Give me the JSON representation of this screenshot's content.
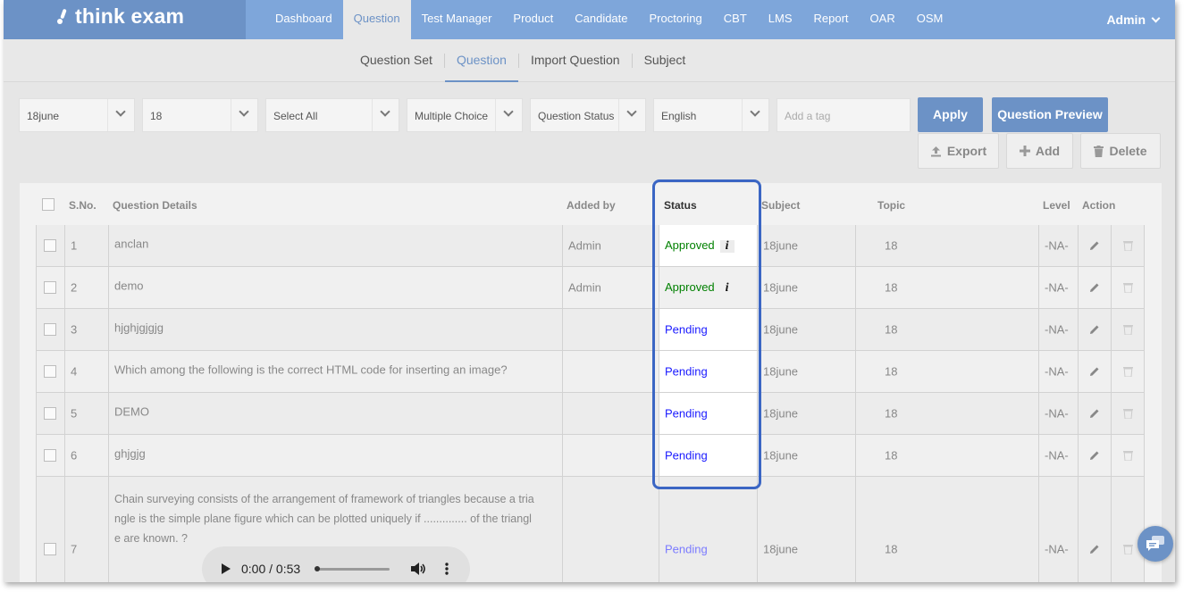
{
  "brand": {
    "logo_text": "think exam"
  },
  "nav": {
    "items": [
      "Dashboard",
      "Question",
      "Test Manager",
      "Product",
      "Candidate",
      "Proctoring",
      "CBT",
      "LMS",
      "Report",
      "OAR",
      "OSM"
    ],
    "active": "Question",
    "user": "Admin"
  },
  "subnav": {
    "items": [
      "Question Set",
      "Question",
      "Import Question",
      "Subject"
    ],
    "active": "Question"
  },
  "filters": {
    "f1": "18june",
    "f2": "18",
    "f3": "Select All",
    "f4": "Multiple Choice",
    "f5": "Question Status",
    "f6": "English",
    "tag_placeholder": "Add a tag"
  },
  "buttons": {
    "apply": "Apply",
    "preview": "Question Preview",
    "export": "Export",
    "add": "Add",
    "delete": "Delete"
  },
  "table": {
    "headers": {
      "sno": "S.No.",
      "details": "Question Details",
      "added_by": "Added by",
      "status": "Status",
      "subject": "Subject",
      "topic": "Topic",
      "level": "Level",
      "action": "Action"
    },
    "rows": [
      {
        "sno": "1",
        "details": "anclan",
        "added_by": "Admin",
        "status": "Approved",
        "subject": "18june",
        "topic": "18",
        "level": "-NA-"
      },
      {
        "sno": "2",
        "details": "demo",
        "added_by": "Admin",
        "status": "Approved",
        "subject": "18june",
        "topic": "18",
        "level": "-NA-"
      },
      {
        "sno": "3",
        "details": "hjghjgjgjg",
        "added_by": "",
        "status": "Pending",
        "subject": "18june",
        "topic": "18",
        "level": "-NA-"
      },
      {
        "sno": "4",
        "details": "Which among the following is the correct HTML code for inserting an image?",
        "added_by": "",
        "status": "Pending",
        "subject": "18june",
        "topic": "18",
        "level": "-NA-"
      },
      {
        "sno": "5",
        "details": "DEMO",
        "added_by": "",
        "status": "Pending",
        "subject": "18june",
        "topic": "18",
        "level": "-NA-"
      },
      {
        "sno": "6",
        "details": "ghjgjg",
        "added_by": "",
        "status": "Pending",
        "subject": "18june",
        "topic": "18",
        "level": "-NA-"
      },
      {
        "sno": "7",
        "details_lines": [
          "Chain surveying consists of the arrangement of framework of triangles because a tria",
          "ngle is the simple plane figure which can be plotted uniquely if .............. of the triangl",
          "e are known. ?"
        ],
        "added_by": "",
        "status": "Pending",
        "subject": "18june",
        "topic": "18",
        "level": "-NA-"
      }
    ]
  },
  "info_icon_label": "i",
  "audio": {
    "time": "0:00 / 0:53"
  },
  "colors": {
    "nav": "#7ea6da",
    "accent": "#6c92c6",
    "approved": "#008000",
    "pending": "#1a1aff",
    "highlight": "#3b66c4"
  }
}
